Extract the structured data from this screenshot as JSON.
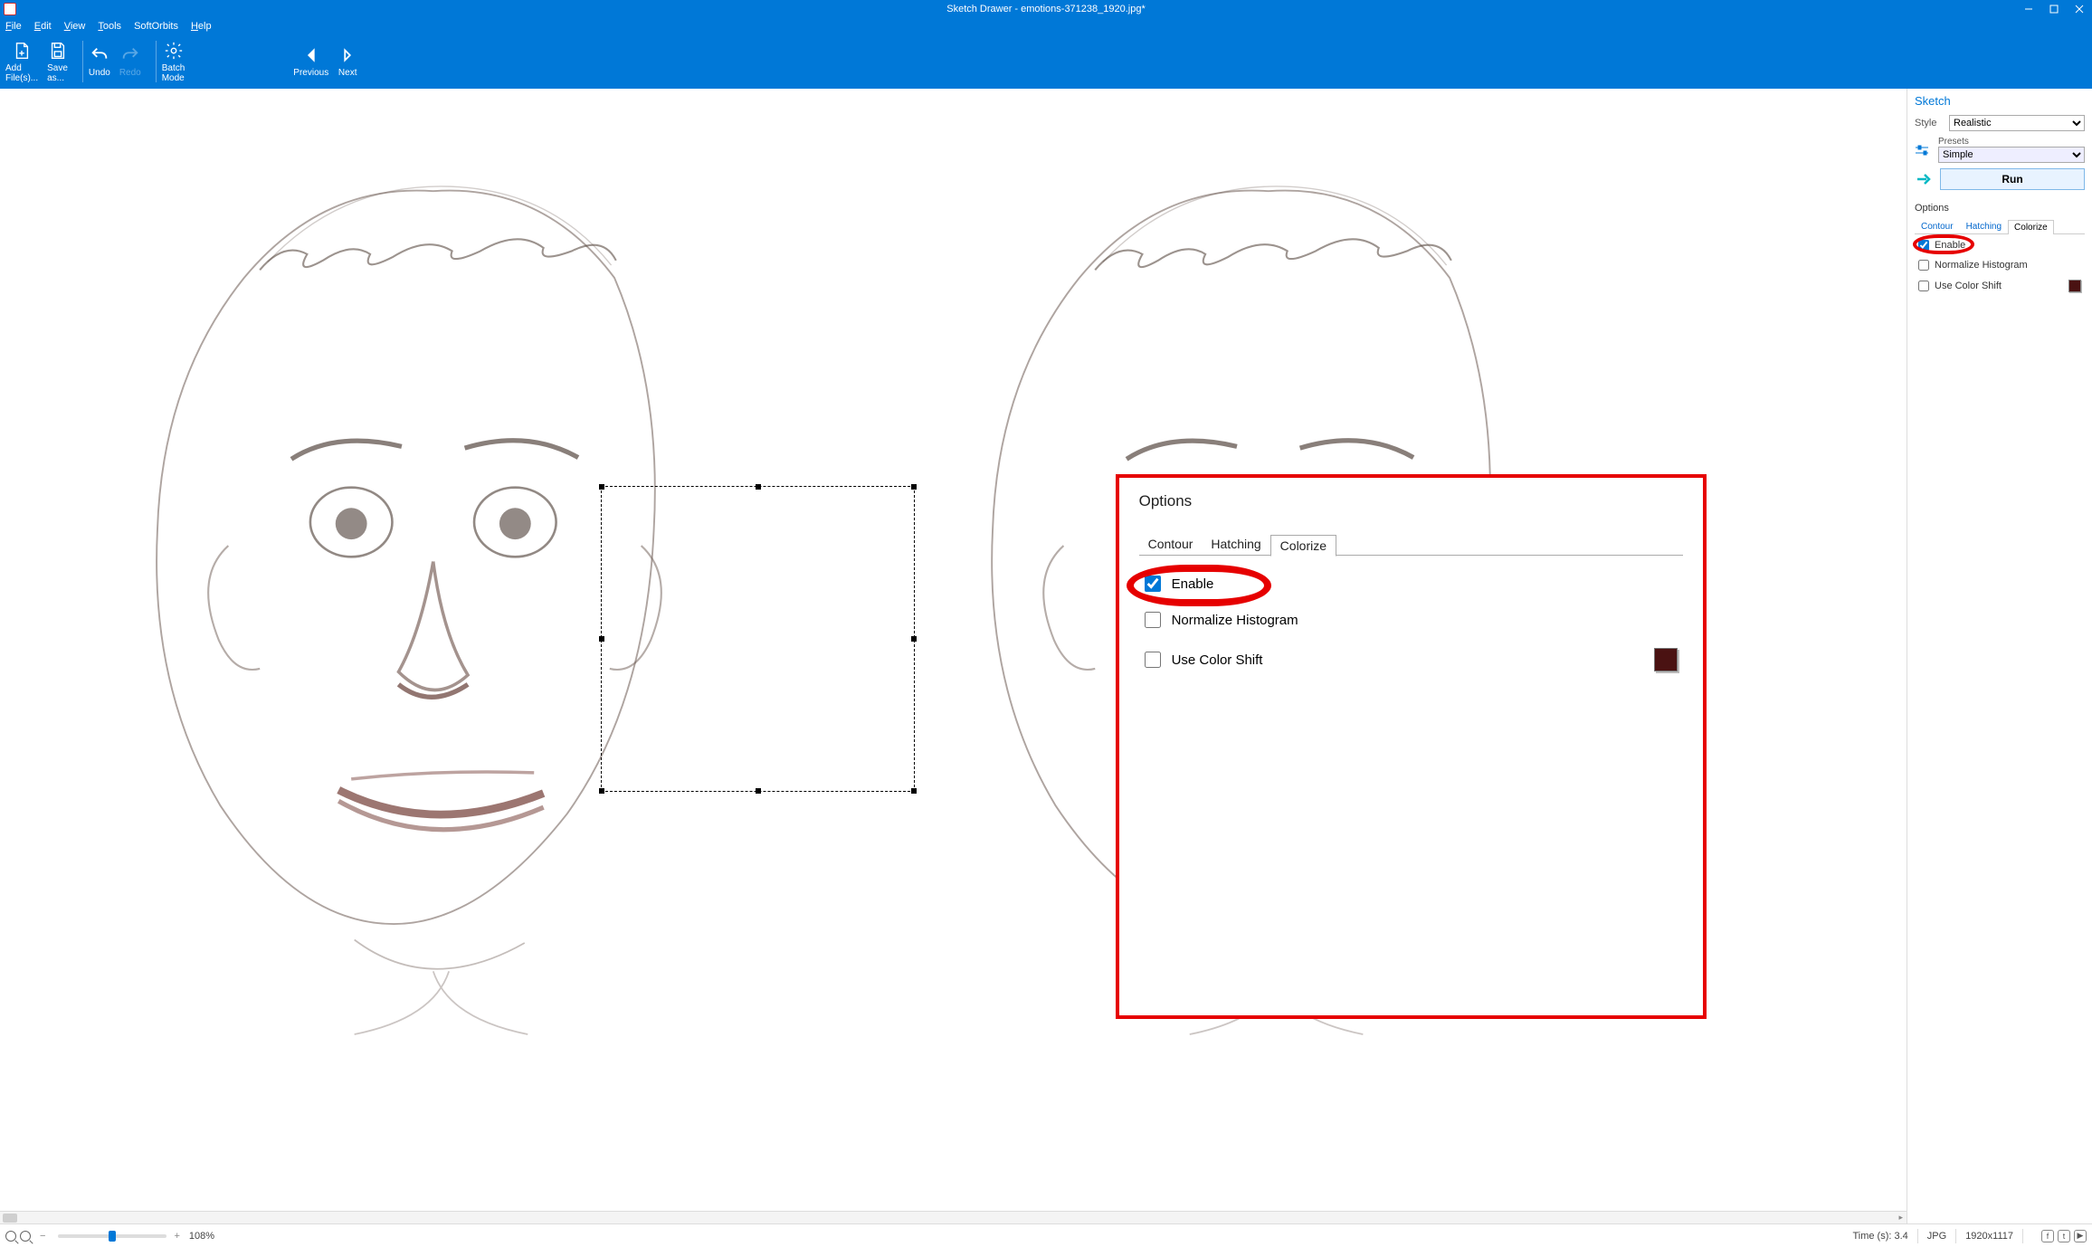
{
  "title": "Sketch Drawer - emotions-371238_1920.jpg*",
  "menu": {
    "file": "File",
    "edit": "Edit",
    "view": "View",
    "tools": "Tools",
    "softorbits": "SoftOrbits",
    "help": "Help"
  },
  "ribbon": {
    "addFiles": "Add\nFile(s)...",
    "saveAs": "Save\nas...",
    "undo": "Undo",
    "redo": "Redo",
    "batch": "Batch\nMode",
    "previous": "Previous",
    "next": "Next"
  },
  "side": {
    "sketch": "Sketch",
    "styleLabel": "Style",
    "styleValue": "Realistic",
    "presetsLabel": "Presets",
    "presetsValue": "Simple",
    "run": "Run",
    "optionsTitle": "Options",
    "tabs": {
      "contour": "Contour",
      "hatching": "Hatching",
      "colorize": "Colorize"
    },
    "enable": "Enable",
    "enableChecked": true,
    "normalize": "Normalize Histogram",
    "normalizeChecked": false,
    "colorShift": "Use Color Shift",
    "colorShiftChecked": false,
    "swatch": "#4a1212"
  },
  "callout": {
    "title": "Options",
    "tabs": {
      "contour": "Contour",
      "hatching": "Hatching",
      "colorize": "Colorize"
    },
    "enable": "Enable",
    "normalize": "Normalize Histogram",
    "colorShift": "Use Color Shift"
  },
  "status": {
    "zoomPct": "108%",
    "timeLabel": "Time (s): 3.4",
    "format": "JPG",
    "dims": "1920x1117"
  },
  "colors": {
    "brand": "#0078d7",
    "annot": "#e60000"
  }
}
